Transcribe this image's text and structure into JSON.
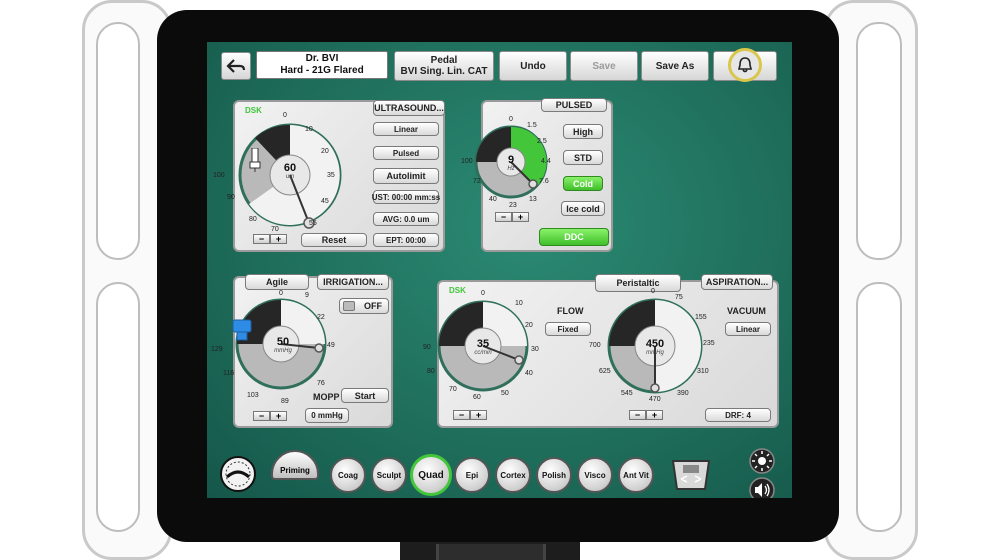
{
  "toolbar": {
    "doctor_name": "Dr. BVI",
    "doctor_tip": "Hard - 21G Flared",
    "pedal_title": "Pedal",
    "pedal_mode": "BVI Sing. Lin. CAT",
    "undo": "Undo",
    "save": "Save",
    "save_as": "Save As"
  },
  "ultrasound": {
    "dsk": "DSK",
    "title": "ULTRASOUND...",
    "value": "60",
    "unit": "um",
    "ticks": [
      "0",
      "10",
      "20",
      "35",
      "45",
      "55",
      "70",
      "80",
      "90",
      "100"
    ],
    "buttons": [
      "Linear",
      "Pulsed",
      "Autolimit"
    ],
    "ust": "UST: 00:00 mm:ss",
    "avg": "AVG: 0.0 um",
    "ept": "EPT: 00:00",
    "minus": "−",
    "plus": "+",
    "reset": "Reset"
  },
  "pulsed": {
    "title": "PULSED",
    "value": "9",
    "unit": "Hz",
    "ticks": [
      "0",
      "1.5",
      "2.5",
      "4.4",
      "7.6",
      "13",
      "23",
      "40",
      "72",
      "100"
    ],
    "modes": [
      "High",
      "STD",
      "Cold",
      "Ice cold"
    ],
    "active_mode": "Cold",
    "ddc": "DDC",
    "minus": "−",
    "plus": "+",
    "accent": "#43c63a"
  },
  "irrigation": {
    "mode": "Agile",
    "title": "IRRIGATION...",
    "toggle": "OFF",
    "value": "50",
    "unit": "mmHg",
    "ticks": [
      "0",
      "22",
      "49",
      "76",
      "89",
      "103",
      "116",
      "129",
      "9"
    ],
    "mopp_label": "MOPP",
    "start": "Start",
    "mopp_value": "0 mmHg",
    "minus": "−",
    "plus": "+"
  },
  "aspiration": {
    "dsk": "DSK",
    "pump": "Peristaltic",
    "title": "ASPIRATION...",
    "flow_label": "FLOW",
    "flow_mode": "Fixed",
    "flow_value": "35",
    "flow_unit": "cc/min",
    "flow_ticks": [
      "0",
      "10",
      "20",
      "30",
      "40",
      "50",
      "60",
      "70",
      "80",
      "90"
    ],
    "vacuum_label": "VACUUM",
    "vacuum_mode": "Linear",
    "vacuum_value": "450",
    "vacuum_unit": "mmHg",
    "vacuum_ticks": [
      "0",
      "75",
      "155",
      "235",
      "310",
      "390",
      "470",
      "545",
      "625",
      "700"
    ],
    "drf": "DRF: 4",
    "minus": "−",
    "plus": "+"
  },
  "bottom": {
    "priming": "Priming",
    "steps": [
      "Coag",
      "Sculpt",
      "Quad",
      "Epi",
      "Cortex",
      "Polish",
      "Visco",
      "Ant Vit"
    ],
    "active_step": "Quad",
    "icons": [
      "bottle-gauge-icon",
      "footswitch-icon",
      "brightness-icon",
      "speaker-icon",
      "bell-icon",
      "back-arrow-icon"
    ]
  }
}
